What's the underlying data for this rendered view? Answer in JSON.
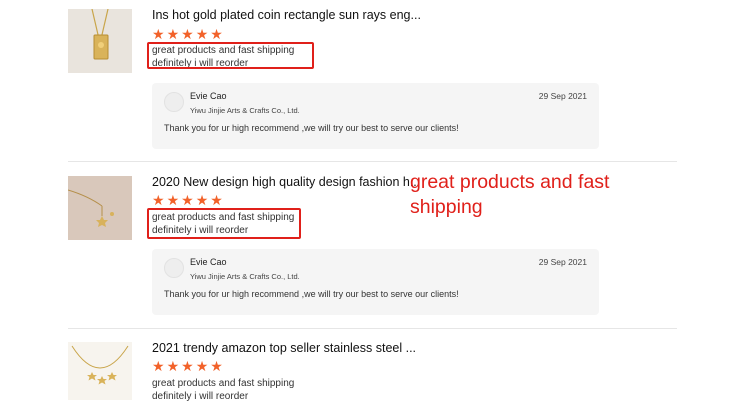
{
  "reviews": [
    {
      "title": "Ins hot gold plated coin rectangle sun rays eng...",
      "stars": 5,
      "comment_line1": "great products and fast shipping",
      "comment_line2": "definitely i will reorder",
      "reply": {
        "seller_name": "Evie Cao",
        "company": "Yiwu Jinjie Arts & Crafts Co., Ltd.",
        "date": "29 Sep 2021",
        "text": "Thank you for ur high recommend ,we will try our best to serve our clients!"
      }
    },
    {
      "title": "2020 New design high quality design fashion h...",
      "stars": 5,
      "comment_line1": "great products and fast shipping",
      "comment_line2": "definitely i will reorder",
      "reply": {
        "seller_name": "Evie Cao",
        "company": "Yiwu Jinjie Arts & Crafts Co., Ltd.",
        "date": "29 Sep 2021",
        "text": "Thank you for ur high recommend ,we will try our best to serve our clients!"
      }
    },
    {
      "title": "2021 trendy amazon top seller stainless steel ...",
      "stars": 5,
      "comment_line1": "great products and fast shipping",
      "comment_line2": "definitely i will reorder"
    }
  ],
  "annotation": "great products and fast shipping",
  "colors": {
    "star": "#f2622a",
    "highlight": "#e0201a",
    "reply_bg": "#f5f5f5"
  },
  "icons": {
    "star": "star-icon",
    "avatar": "seller-avatar"
  }
}
